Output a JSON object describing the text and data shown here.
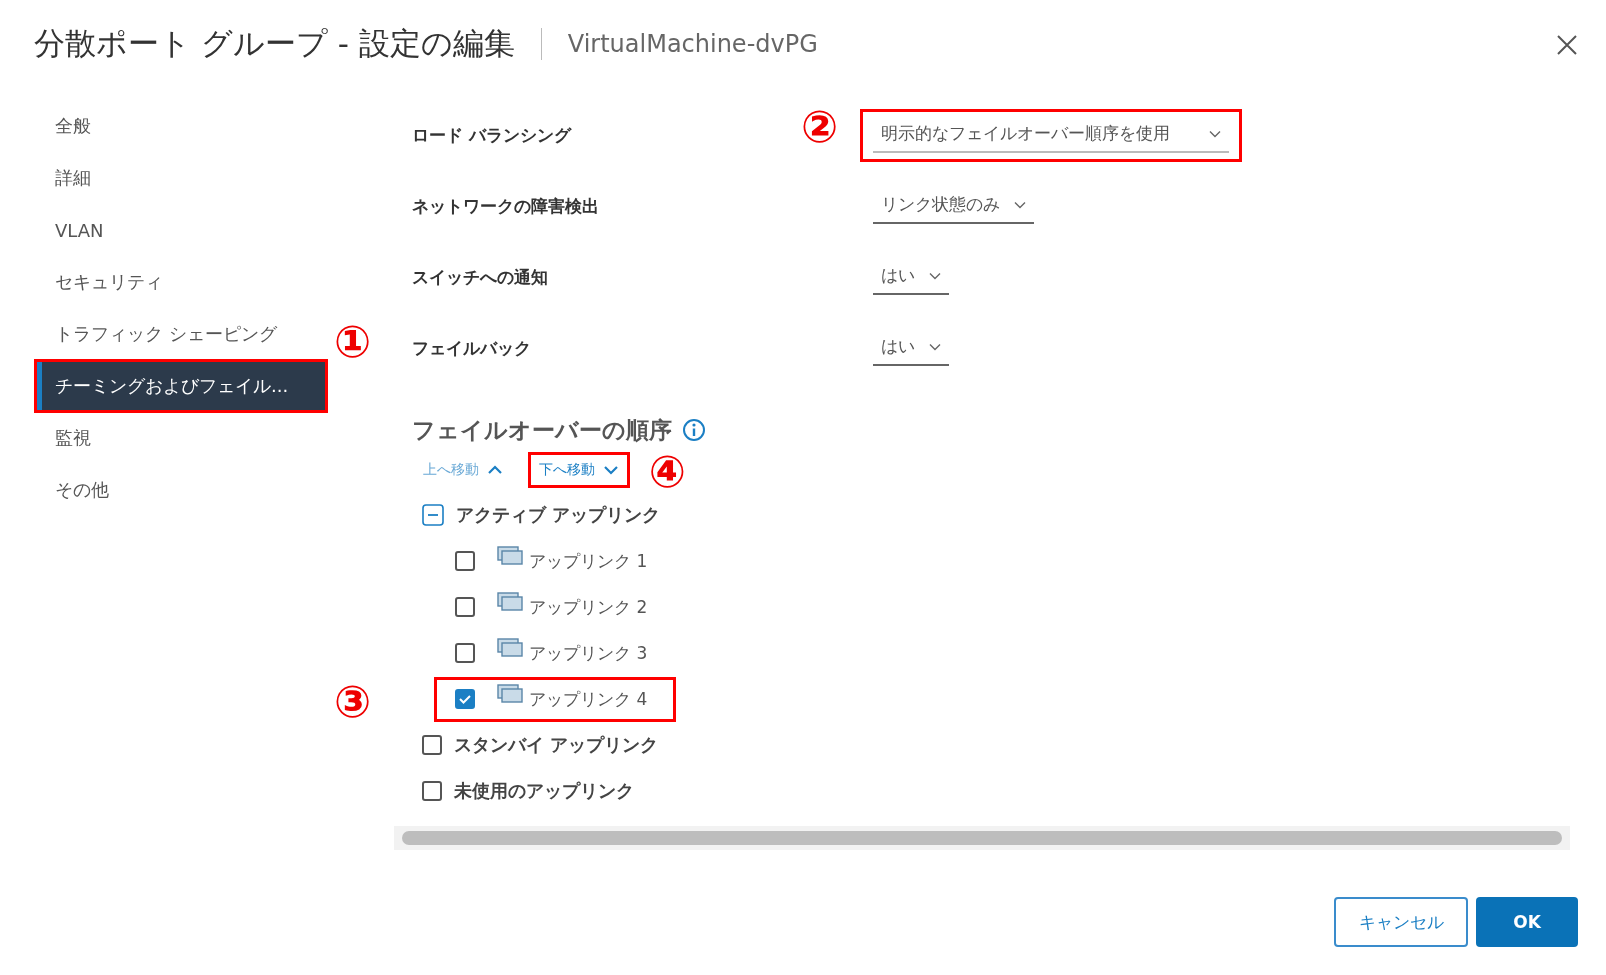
{
  "dialog": {
    "title": "分散ポート グループ - 設定の編集",
    "subtitle": "VirtualMachine-dvPG"
  },
  "sidebar": {
    "items": [
      {
        "label": "全般",
        "selected": false,
        "highlighted": false
      },
      {
        "label": "詳細",
        "selected": false,
        "highlighted": false
      },
      {
        "label": "VLAN",
        "selected": false,
        "highlighted": false
      },
      {
        "label": "セキュリティ",
        "selected": false,
        "highlighted": false
      },
      {
        "label": "トラフィック シェーピング",
        "selected": false,
        "highlighted": false
      },
      {
        "label": "チーミングおよびフェイル...",
        "selected": true,
        "highlighted": true,
        "callout": "①"
      },
      {
        "label": "監視",
        "selected": false,
        "highlighted": false
      },
      {
        "label": "その他",
        "selected": false,
        "highlighted": false
      }
    ]
  },
  "settings": [
    {
      "label": "ロード バランシング",
      "value": "明示的なフェイルオーバー順序を使用",
      "highlighted": true,
      "callout": "②"
    },
    {
      "label": "ネットワークの障害検出",
      "value": "リンク状態のみ",
      "highlighted": false
    },
    {
      "label": "スイッチへの通知",
      "value": "はい",
      "highlighted": false
    },
    {
      "label": "フェイルバック",
      "value": "はい",
      "highlighted": false
    }
  ],
  "failover_order": {
    "heading": "フェイルオーバーの順序",
    "move_buttons": [
      {
        "kind": "up",
        "label": "上へ移動",
        "highlighted": false
      },
      {
        "kind": "down",
        "label": "下へ移動",
        "highlighted": true,
        "callout": "④"
      }
    ],
    "groups": [
      {
        "kind": "toggle",
        "label": "アクティブ アップリンク",
        "expanded": true,
        "children": [
          {
            "label": "アップリンク 1",
            "checked": false,
            "highlighted": false
          },
          {
            "label": "アップリンク 2",
            "checked": false,
            "highlighted": false
          },
          {
            "label": "アップリンク 3",
            "checked": false,
            "highlighted": false
          },
          {
            "label": "アップリンク 4",
            "checked": true,
            "highlighted": true,
            "callout": "③"
          }
        ]
      },
      {
        "kind": "checkbox",
        "label": "スタンバイ アップリンク",
        "checked": false
      },
      {
        "kind": "checkbox",
        "label": "未使用のアップリンク",
        "checked": false
      }
    ]
  },
  "buttons": [
    {
      "kind": "secondary",
      "label": "キャンセル"
    },
    {
      "kind": "primary",
      "label": "OK"
    }
  ]
}
